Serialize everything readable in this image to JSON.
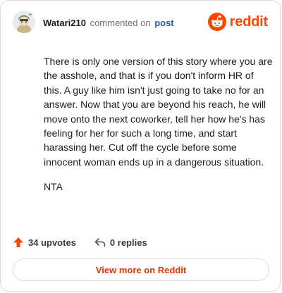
{
  "header": {
    "username": "Watari210",
    "action_text": "commented on",
    "post_link": "post",
    "brand_name": "reddit"
  },
  "comment": {
    "paragraphs": [
      "There is only one version of this story where you are the asshole, and that is if you don't inform HR of this. A guy like him isn't just going to take no for an answer. Now that you are beyond his reach, he will move onto the next coworker, tell her how he's has feeling for her for such a long time, and start harassing her. Cut off the cycle before some innocent woman ends up in a dangerous situation.",
      "NTA"
    ]
  },
  "actions": {
    "upvotes": "34 upvotes",
    "replies": "0 replies"
  },
  "footer": {
    "view_more": "View more on Reddit"
  },
  "colors": {
    "brand": "#ff4500",
    "link": "#2c5aa0",
    "view_more_text": "#d93a00"
  },
  "icons": [
    "avatar",
    "reddit-logo-icon",
    "upvote-arrow-icon",
    "reply-arrow-icon"
  ]
}
